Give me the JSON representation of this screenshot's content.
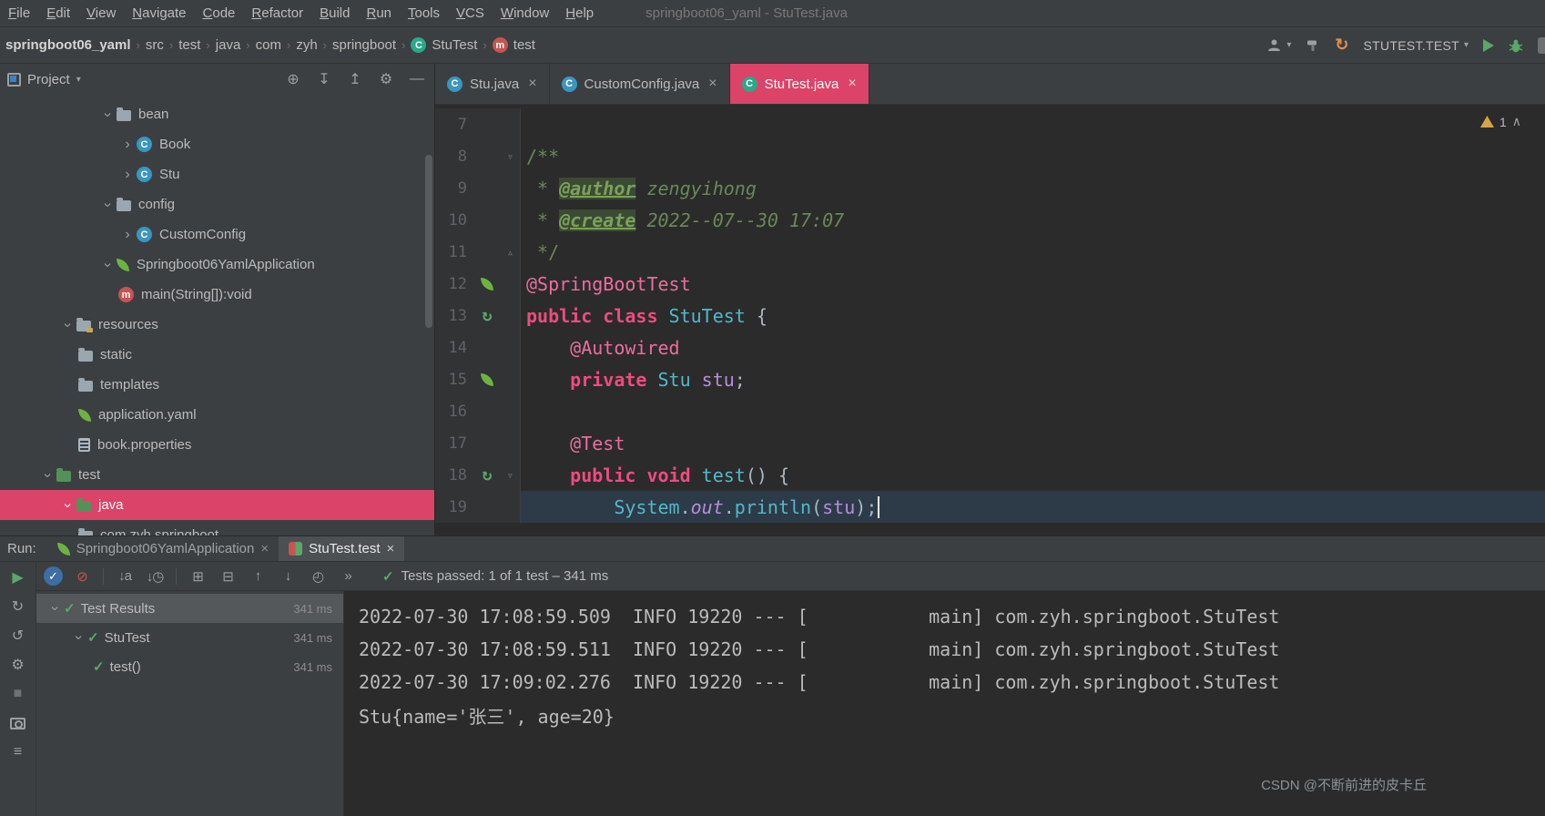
{
  "colors": {
    "accent": "#DB4368",
    "panel_bg": "#3c3f41",
    "editor_bg": "#2b2b2b",
    "keyword_pink": "#ED4C7F",
    "class_cyan": "#55B7C8",
    "comment_green": "#6A8759",
    "success_green": "#59A869",
    "warning_yellow": "#D9A343",
    "spring_green": "#6DB33F"
  },
  "icons": {
    "close": "×",
    "chevron": "›",
    "check": "✓",
    "caret_up": "∧",
    "menu_chevron": "▾",
    "fold_start": "▿",
    "fold_end": "▵",
    "rerun": "↻"
  },
  "menubar": {
    "items": [
      "File",
      "Edit",
      "View",
      "Navigate",
      "Code",
      "Refactor",
      "Build",
      "Run",
      "Tools",
      "VCS",
      "Window",
      "Help"
    ],
    "window_title": "springboot06_yaml - StuTest.java"
  },
  "navbar": {
    "breadcrumbs": [
      {
        "label": "springboot06_yaml",
        "bold": true
      },
      {
        "label": "src"
      },
      {
        "label": "test"
      },
      {
        "label": "java"
      },
      {
        "label": "com"
      },
      {
        "label": "zyh"
      },
      {
        "label": "springboot"
      },
      {
        "label": "StuTest",
        "icon": "test-class"
      },
      {
        "label": "test",
        "icon": "method"
      }
    ],
    "run_config": "STUTEST.TEST",
    "actions": [
      {
        "name": "profile-button",
        "icon": "person",
        "chevron": true
      },
      {
        "name": "build-hammer-button",
        "icon": "hammer"
      },
      {
        "name": "reload-button",
        "icon": "reload"
      },
      {
        "name": "run-config-selector",
        "label": "STUTEST.TEST",
        "chevron": true
      },
      {
        "name": "run-button",
        "icon": "play"
      },
      {
        "name": "debug-button",
        "icon": "bug"
      },
      {
        "name": "coverage-button",
        "icon": "coverage"
      }
    ]
  },
  "project": {
    "title": "Project",
    "header_actions": [
      {
        "name": "locate-file-button",
        "glyph": "⊕"
      },
      {
        "name": "expand-all-button",
        "glyph": "↧"
      },
      {
        "name": "collapse-all-button",
        "glyph": "↥"
      },
      {
        "name": "settings-gear-button",
        "glyph": "⚙"
      },
      {
        "name": "hide-panel-button",
        "glyph": "—"
      }
    ],
    "tree": [
      {
        "label": "bean",
        "icon": "folder",
        "chevron": "open",
        "depth": 4
      },
      {
        "label": "Book",
        "icon": "class",
        "chevron": "closed",
        "depth": 5
      },
      {
        "label": "Stu",
        "icon": "class",
        "chevron": "closed",
        "depth": 5
      },
      {
        "label": "config",
        "icon": "folder",
        "chevron": "open",
        "depth": 4
      },
      {
        "label": "CustomConfig",
        "icon": "class",
        "chevron": "closed",
        "depth": 5
      },
      {
        "label": "Springboot06YamlApplication",
        "icon": "spring",
        "chevron": "open",
        "depth": 4
      },
      {
        "label": "main(String[]):void",
        "icon": "method",
        "depth": 5
      },
      {
        "label": "resources",
        "icon": "folder-resources",
        "chevron": "open",
        "depth": 2
      },
      {
        "label": "static",
        "icon": "folder",
        "depth": 3
      },
      {
        "label": "templates",
        "icon": "folder",
        "depth": 3
      },
      {
        "label": "application.yaml",
        "icon": "spring",
        "depth": 3
      },
      {
        "label": "book.properties",
        "icon": "properties",
        "depth": 3
      },
      {
        "label": "test",
        "icon": "folder-test",
        "chevron": "open",
        "depth": 1
      },
      {
        "label": "java",
        "icon": "folder-green",
        "chevron": "open",
        "depth": 2,
        "selected": true
      },
      {
        "label": "com.zyh.springboot",
        "icon": "package",
        "depth": 3
      }
    ]
  },
  "editor": {
    "tabs": [
      {
        "label": "Stu.java",
        "icon": "class"
      },
      {
        "label": "CustomConfig.java",
        "icon": "class"
      },
      {
        "label": "StuTest.java",
        "icon": "test-class",
        "active": true
      }
    ],
    "warning_count": "1",
    "lines": [
      {
        "num": "7",
        "tokens": []
      },
      {
        "num": "8",
        "fold": "start",
        "tokens": [
          {
            "t": "/**",
            "c": "comment"
          }
        ]
      },
      {
        "num": "9",
        "tokens": [
          {
            "t": " * ",
            "c": "comment"
          },
          {
            "t": "@author",
            "c": "doctag"
          },
          {
            "t": " ",
            "c": "comment"
          },
          {
            "t": "zengyihong",
            "c": "docval"
          }
        ]
      },
      {
        "num": "10",
        "tokens": [
          {
            "t": " * ",
            "c": "comment"
          },
          {
            "t": "@create",
            "c": "doctag"
          },
          {
            "t": " ",
            "c": "comment"
          },
          {
            "t": "2022--07--30 17:07",
            "c": "docval"
          }
        ]
      },
      {
        "num": "11",
        "fold": "end",
        "tokens": [
          {
            "t": " */",
            "c": "comment"
          }
        ]
      },
      {
        "num": "12",
        "gicon": "leaf",
        "tokens": [
          {
            "t": "@SpringBootTest",
            "c": "annotation"
          }
        ]
      },
      {
        "num": "13",
        "gicon": "run",
        "tokens": [
          {
            "t": "public class ",
            "c": "keyword"
          },
          {
            "t": "StuTest",
            "c": "classname"
          },
          {
            "t": " {",
            "c": "plain"
          }
        ]
      },
      {
        "num": "14",
        "tokens": [
          {
            "t": "    ",
            "c": "plain"
          },
          {
            "t": "@Autowired",
            "c": "annotation"
          }
        ]
      },
      {
        "num": "15",
        "gicon": "leaf",
        "tokens": [
          {
            "t": "    ",
            "c": "plain"
          },
          {
            "t": "private ",
            "c": "keyword"
          },
          {
            "t": "Stu",
            "c": "classname"
          },
          {
            "t": " ",
            "c": "plain"
          },
          {
            "t": "stu",
            "c": "field"
          },
          {
            "t": ";",
            "c": "plain"
          }
        ]
      },
      {
        "num": "16",
        "tokens": []
      },
      {
        "num": "17",
        "tokens": [
          {
            "t": "    ",
            "c": "plain"
          },
          {
            "t": "@Test",
            "c": "annotation"
          }
        ]
      },
      {
        "num": "18",
        "gicon": "run",
        "fold": "start",
        "tokens": [
          {
            "t": "    ",
            "c": "plain"
          },
          {
            "t": "public void ",
            "c": "keyword"
          },
          {
            "t": "test",
            "c": "method"
          },
          {
            "t": "() {",
            "c": "plain"
          }
        ]
      },
      {
        "num": "19",
        "current": true,
        "caret": true,
        "tokens": [
          {
            "t": "        ",
            "c": "plain"
          },
          {
            "t": "System",
            "c": "classname"
          },
          {
            "t": ".",
            "c": "plain"
          },
          {
            "t": "out",
            "c": "field-italic"
          },
          {
            "t": ".",
            "c": "plain"
          },
          {
            "t": "println",
            "c": "method"
          },
          {
            "t": "(",
            "c": "plain"
          },
          {
            "t": "stu",
            "c": "field"
          },
          {
            "t": ")",
            "c": "plain"
          },
          {
            "t": ";",
            "c": "plain"
          }
        ]
      }
    ]
  },
  "run": {
    "label": "Run:",
    "tabs": [
      {
        "label": "Springboot06YamlApplication",
        "icon": "spring"
      },
      {
        "label": "StuTest.test",
        "icon": "junit",
        "active": true
      }
    ],
    "toolbar": [
      {
        "name": "show-passed-toggle",
        "glyph": "✓",
        "style": "blue-circle"
      },
      {
        "name": "show-ignored-toggle",
        "glyph": "⊘",
        "color": "#C75450"
      },
      {
        "name": "separator"
      },
      {
        "name": "sort-alphabetically-button",
        "glyph": "↓a"
      },
      {
        "name": "sort-by-duration-button",
        "glyph": "↓◷"
      },
      {
        "name": "separator"
      },
      {
        "name": "expand-all-button",
        "glyph": "⊞"
      },
      {
        "name": "collapse-all-button",
        "glyph": "⊟"
      },
      {
        "name": "previous-failed-button",
        "glyph": "↑"
      },
      {
        "name": "next-failed-button",
        "glyph": "↓"
      },
      {
        "name": "test-history-button",
        "glyph": "◴"
      },
      {
        "name": "more-options-button",
        "glyph": "»"
      }
    ],
    "left_toolbar": [
      {
        "name": "rerun-button",
        "glyph": "▶",
        "color": "#59A869"
      },
      {
        "name": "rerun-failed-button",
        "glyph": "↻"
      },
      {
        "name": "toggle-auto-test-button",
        "glyph": "↺"
      },
      {
        "name": "settings-wrench-button",
        "glyph": "⚙"
      },
      {
        "name": "stop-button",
        "glyph": "■",
        "color": "#6e7072"
      },
      {
        "name": "screenshot-button",
        "glyph": "camera"
      },
      {
        "name": "options-menu-button",
        "glyph": "≡"
      }
    ],
    "status": "Tests passed: 1 of 1 test – 341 ms",
    "test_tree": [
      {
        "label": "Test Results",
        "duration": "341 ms",
        "chevron": true,
        "selected": true,
        "depth": 0
      },
      {
        "label": "StuTest",
        "duration": "341 ms",
        "chevron": true,
        "depth": 1
      },
      {
        "label": "test()",
        "duration": "341 ms",
        "depth": 2
      }
    ],
    "console": [
      "2022-07-30 17:08:59.509  INFO 19220 --- [           main] com.zyh.springboot.StuTest",
      "2022-07-30 17:08:59.511  INFO 19220 --- [           main] com.zyh.springboot.StuTest",
      "2022-07-30 17:09:02.276  INFO 19220 --- [           main] com.zyh.springboot.StuTest",
      "Stu{name='张三', age=20}"
    ],
    "watermark": "CSDN @不断前进的皮卡丘"
  }
}
